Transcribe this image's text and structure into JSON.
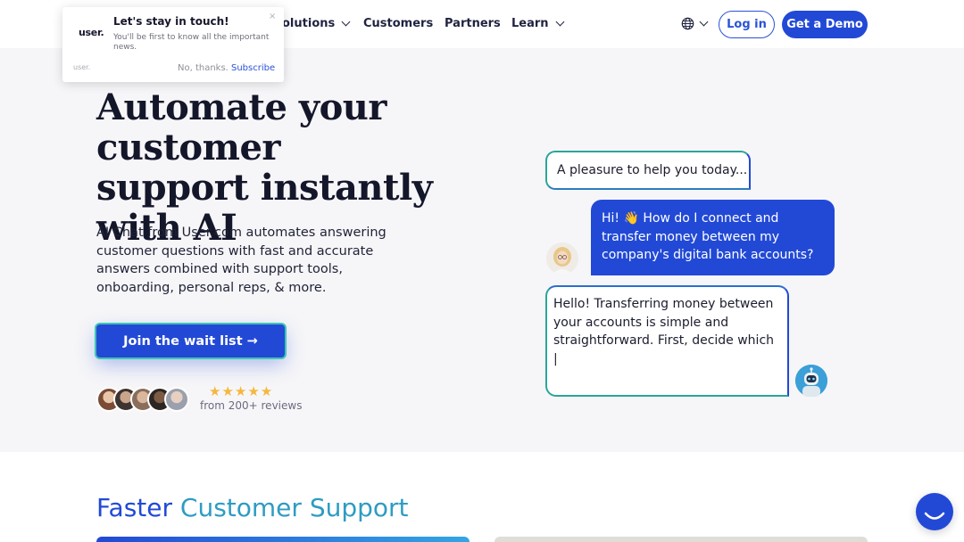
{
  "nav": {
    "solutions_label": "olutions",
    "customers_label": "Customers",
    "partners_label": "Partners",
    "learn_label": "Learn",
    "login_label": "Log in",
    "demo_label": "Get a Demo"
  },
  "hero": {
    "title": "Automate your customer support instantly with AI",
    "description": "AI Chat from User.com automates answering customer questions with fast and accurate answers combined with support tools, onboarding, personal reps, & more.",
    "cta_label": "Join the wait list →",
    "stars": "★★★★★",
    "reviews_text": "from 200+ reviews"
  },
  "chat": {
    "bubble_agent_intro": "A pleasure to help you today...",
    "bubble_user_question": "Hi! 👋 How do I connect and transfer money between my company's digital bank accounts?",
    "bubble_ai_answer": "Hello! Transferring money between your accounts is simple and straightforward. First, decide which |"
  },
  "features": {
    "heading_part1": "Faster ",
    "heading_part2": "Customer Support"
  },
  "popup": {
    "logo": "user.",
    "title": "Let's stay in touch!",
    "text": "You'll be first to know all the important news.",
    "close": "×",
    "brand": "user.",
    "dismiss_label": "No, thanks.",
    "subscribe_label": "Subscribe"
  },
  "colors": {
    "brand_blue": "#2249d6",
    "accent_teal": "#2aa59a",
    "star_gold": "#f4b73f",
    "hero_bg": "#f6f6f8"
  },
  "icons": [
    "globe-icon",
    "chevron-down-icon",
    "close-icon",
    "robot-icon",
    "chat-launcher-icon"
  ]
}
